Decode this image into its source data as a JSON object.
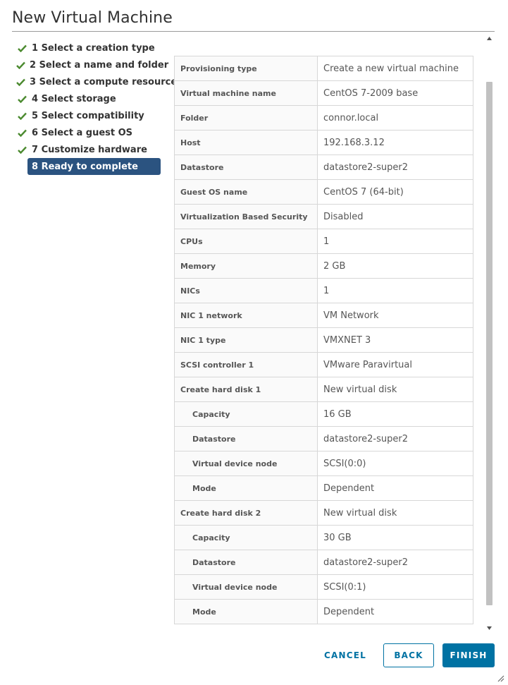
{
  "dialog": {
    "title": "New Virtual Machine"
  },
  "steps": [
    {
      "label": "1 Select a creation type",
      "done": true
    },
    {
      "label": "2 Select a name and folder",
      "done": true
    },
    {
      "label": "3 Select a compute resource",
      "done": true
    },
    {
      "label": "4 Select storage",
      "done": true
    },
    {
      "label": "5 Select compatibility",
      "done": true
    },
    {
      "label": "6 Select a guest OS",
      "done": true
    },
    {
      "label": "7 Customize hardware",
      "done": true
    },
    {
      "label": "8 Ready to complete",
      "done": false,
      "current": true
    }
  ],
  "summary": [
    {
      "key": "Provisioning type",
      "value": "Create a new virtual machine"
    },
    {
      "key": "Virtual machine name",
      "value": "CentOS 7-2009 base"
    },
    {
      "key": "Folder",
      "value": "connor.local"
    },
    {
      "key": "Host",
      "value": "192.168.3.12"
    },
    {
      "key": "Datastore",
      "value": "datastore2-super2"
    },
    {
      "key": "Guest OS name",
      "value": "CentOS 7 (64-bit)"
    },
    {
      "key": "Virtualization Based Security",
      "value": "Disabled"
    },
    {
      "key": "CPUs",
      "value": "1"
    },
    {
      "key": "Memory",
      "value": "2 GB"
    },
    {
      "key": "NICs",
      "value": "1"
    },
    {
      "key": "NIC 1 network",
      "value": "VM Network"
    },
    {
      "key": "NIC 1 type",
      "value": "VMXNET 3"
    },
    {
      "key": "SCSI controller 1",
      "value": "VMware Paravirtual"
    },
    {
      "key": "Create hard disk 1",
      "value": "New virtual disk"
    },
    {
      "key": "Capacity",
      "value": "16 GB",
      "sub": true
    },
    {
      "key": "Datastore",
      "value": "datastore2-super2",
      "sub": true
    },
    {
      "key": "Virtual device node",
      "value": "SCSI(0:0)",
      "sub": true
    },
    {
      "key": "Mode",
      "value": "Dependent",
      "sub": true
    },
    {
      "key": "Create hard disk 2",
      "value": "New virtual disk"
    },
    {
      "key": "Capacity",
      "value": "30 GB",
      "sub": true
    },
    {
      "key": "Datastore",
      "value": "datastore2-super2",
      "sub": true
    },
    {
      "key": "Virtual device node",
      "value": "SCSI(0:1)",
      "sub": true
    },
    {
      "key": "Mode",
      "value": "Dependent",
      "sub": true
    }
  ],
  "buttons": {
    "cancel": "CANCEL",
    "back": "BACK",
    "finish": "FINISH"
  },
  "colors": {
    "accent": "#0072a3",
    "current_step": "#2b5380",
    "check": "#4b8a2f"
  },
  "icons": {
    "step_done": "checkmark-icon",
    "scroll_up": "scroll-up-arrow-icon",
    "scroll_down": "scroll-down-arrow-icon",
    "resize": "resize-grip-icon"
  }
}
